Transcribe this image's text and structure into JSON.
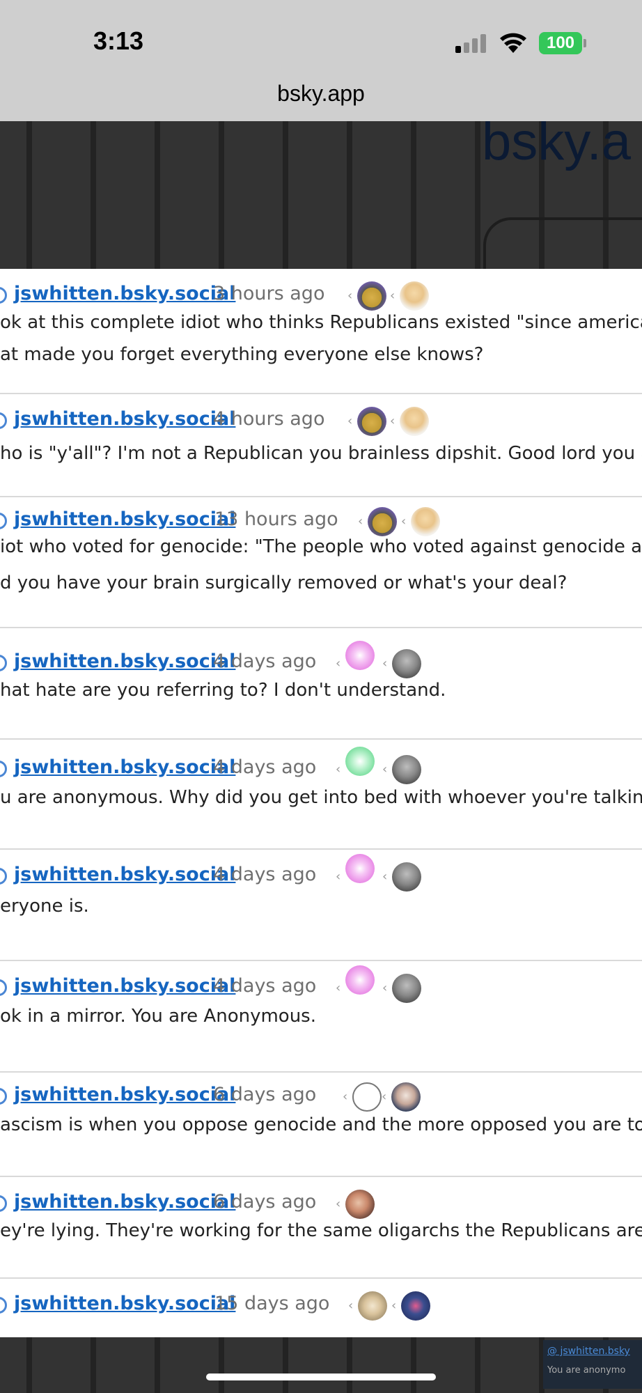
{
  "status_bar": {
    "time": "3:13",
    "battery": "100",
    "url": "bsky.app"
  },
  "backdrop": {
    "logo_text": "bsky.a"
  },
  "feed": [
    {
      "handle": "jswhitten.bsky.social",
      "time": "3 hours ago",
      "lines": [
        "ok at this complete idiot who thinks Republicans existed \"since america s",
        "at made you forget everything everyone else knows?"
      ],
      "avatars": [
        "minion-avatar",
        "blonde-avatar"
      ]
    },
    {
      "handle": "jswhitten.bsky.social",
      "time": "4 hours ago",
      "lines": [
        "ho is \"y'all\"? I'm not a Republican you brainless dipshit. Good lord you ar"
      ],
      "avatars": [
        "minion-avatar",
        "blonde-avatar"
      ]
    },
    {
      "handle": "jswhitten.bsky.social",
      "time": "13 hours ago",
      "lines": [
        "iot who voted for genocide: \"The people who voted against genocide are",
        "d you have your brain surgically removed or what's your deal?"
      ],
      "avatars": [
        "minion-avatar",
        "blonde-avatar"
      ]
    },
    {
      "handle": "jswhitten.bsky.social",
      "time": "4 days ago",
      "lines": [
        "hat hate are you referring to? I don't understand."
      ],
      "avatars": [
        "pink-avatar",
        "bald-avatar"
      ]
    },
    {
      "handle": "jswhitten.bsky.social",
      "time": "4 days ago",
      "lines": [
        "u are anonymous. Why did you get into bed with whoever you're talking"
      ],
      "avatars": [
        "green-avatar",
        "bald-avatar"
      ]
    },
    {
      "handle": "jswhitten.bsky.social",
      "time": "4 days ago",
      "lines": [
        "eryone is."
      ],
      "avatars": [
        "pink-avatar",
        "bald-avatar"
      ]
    },
    {
      "handle": "jswhitten.bsky.social",
      "time": "4 days ago",
      "lines": [
        "ok in a mirror. You are Anonymous."
      ],
      "avatars": [
        "pink-avatar",
        "bald-avatar"
      ]
    },
    {
      "handle": "jswhitten.bsky.social",
      "time": "6 days ago",
      "lines": [
        "ascism is when you oppose genocide and the more opposed you are to g"
      ],
      "avatars": [
        "octopus-avatar",
        "man-avatar"
      ]
    },
    {
      "handle": "jswhitten.bsky.social",
      "time": "6 days ago",
      "lines": [
        "ey're lying. They're working for the same oligarchs the Republicans are a"
      ],
      "avatars": [
        "face-avatar"
      ]
    },
    {
      "handle": "jswhitten.bsky.social",
      "time": "15 days ago",
      "lines": [],
      "avatars": [
        "dog-avatar",
        "navy-avatar"
      ]
    }
  ],
  "bottom_preview": {
    "handle": "@ jswhitten.bsky",
    "text": "You are anonymo"
  }
}
